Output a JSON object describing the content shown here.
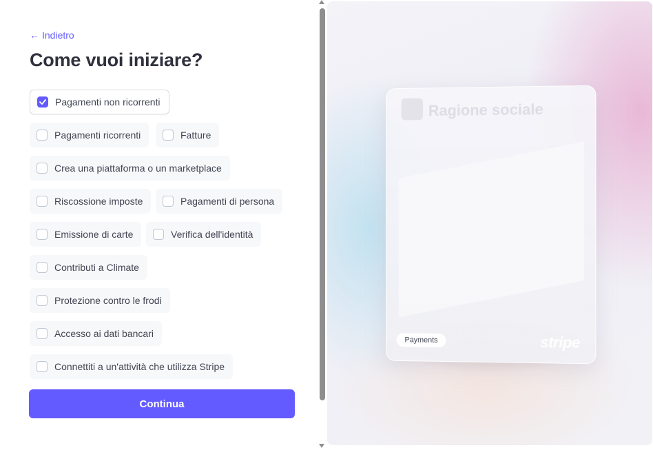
{
  "nav": {
    "back_label": "Indietro"
  },
  "page": {
    "title": "Come vuoi iniziare?"
  },
  "options": [
    {
      "label": "Pagamenti non ricorrenti",
      "checked": true
    },
    {
      "label": "Pagamenti ricorrenti",
      "checked": false
    },
    {
      "label": "Fatture",
      "checked": false
    },
    {
      "label": "Crea una piattaforma o un marketplace",
      "checked": false
    },
    {
      "label": "Riscossione imposte",
      "checked": false
    },
    {
      "label": "Pagamenti di persona",
      "checked": false
    },
    {
      "label": "Emissione di carte",
      "checked": false
    },
    {
      "label": "Verifica dell'identità",
      "checked": false
    },
    {
      "label": "Contributi a Climate",
      "checked": false
    },
    {
      "label": "Protezione contro le frodi",
      "checked": false
    },
    {
      "label": "Accesso ai dati bancari",
      "checked": false
    },
    {
      "label": "Connettiti a un'attività che utilizza Stripe",
      "checked": false
    }
  ],
  "cta": {
    "label": "Continua"
  },
  "preview": {
    "company_placeholder": "Ragione sociale",
    "product_badge": "Payments",
    "brand": "stripe"
  },
  "colors": {
    "accent": "#635bff",
    "text": "#30313d",
    "option_bg": "#f6f8fa"
  },
  "icons": {
    "back": "arrow-left-icon",
    "check": "checkmark-icon"
  }
}
